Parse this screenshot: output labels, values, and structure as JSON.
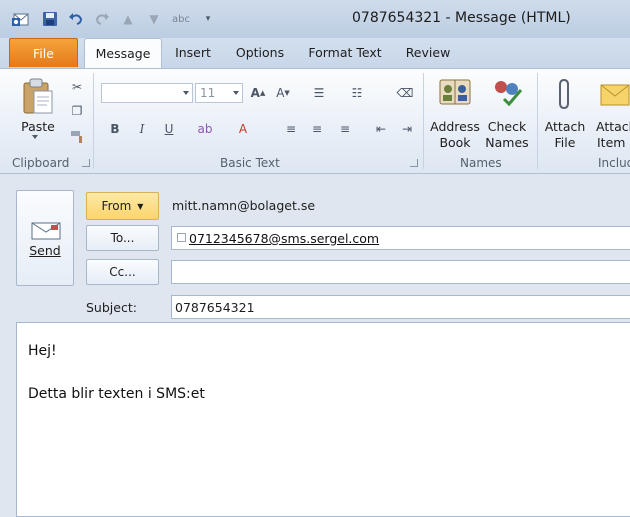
{
  "window": {
    "title": "0787654321 - Message (HTML)"
  },
  "tabs": [
    "File",
    "Message",
    "Insert",
    "Options",
    "Format Text",
    "Review"
  ],
  "ribbon": {
    "clipboard": {
      "paste_label": "Paste",
      "group_label": "Clipboard"
    },
    "basic_text": {
      "font_size": "11",
      "group_label": "Basic Text"
    },
    "names": {
      "address_book_line1": "Address",
      "address_book_line2": "Book",
      "check_names_line1": "Check",
      "check_names_line2": "Names",
      "group_label": "Names"
    },
    "include": {
      "attach_file_line1": "Attach",
      "attach_file_line2": "File",
      "attach_item_line1": "Attach",
      "attach_item_line2": "Item",
      "group_label": "Includ"
    }
  },
  "compose": {
    "send_label": "Send",
    "from_label": "From",
    "from_value": "mitt.namn@bolaget.se",
    "to_label": "To...",
    "to_value": "0712345678@sms.sergel.com",
    "cc_label": "Cc...",
    "cc_value": "",
    "subject_label": "Subject:",
    "subject_value": "0787654321"
  },
  "body": {
    "lines": [
      "Hej!",
      "Detta blir texten i SMS:et"
    ]
  },
  "colors": {
    "file_tab": "#e5791a",
    "from_button": "#fbd56a",
    "ribbon_bg": "#e9eff7"
  },
  "icons": [
    "outlook-icon",
    "save-icon",
    "undo-icon",
    "redo-icon",
    "up-icon",
    "down-icon",
    "spelling-icon",
    "customize-icon"
  ]
}
